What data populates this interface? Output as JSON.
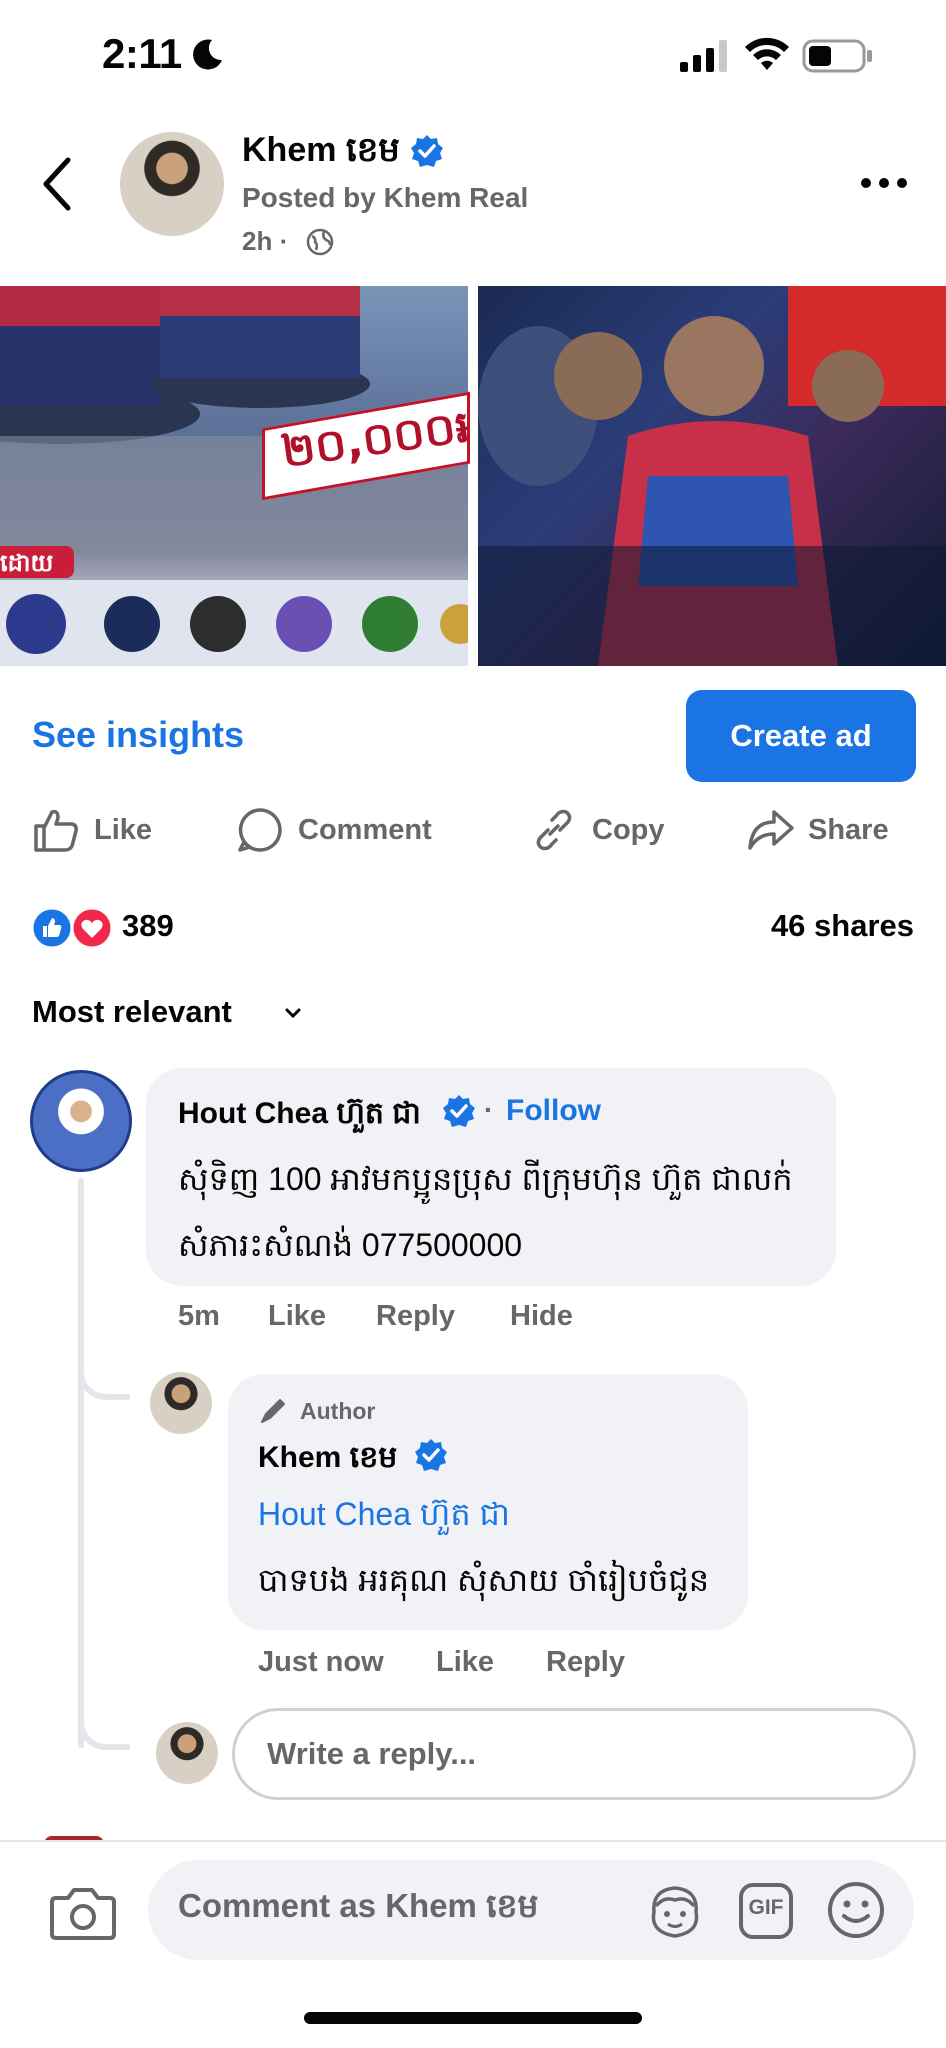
{
  "status_bar": {
    "time": "2:11"
  },
  "post": {
    "author_name": "Khem ខេម",
    "posted_by": "Posted by Khem Real",
    "time": "2h ·",
    "image_price_text": "២០,០០០៛",
    "image_banner_text": "ដោយ"
  },
  "insights": {
    "see_insights": "See insights",
    "create_ad": "Create ad"
  },
  "actions": {
    "like": "Like",
    "comment": "Comment",
    "copy": "Copy",
    "share": "Share"
  },
  "stats": {
    "reactions_count": "389",
    "shares": "46 shares"
  },
  "sort": {
    "label": "Most relevant"
  },
  "comment1": {
    "name": "Hout Chea ហ៊ួត ជា",
    "dot": "·",
    "follow": "Follow",
    "text": "សុំទិញ 100 អាវមកប្អូនប្រុស ពីក្រុមហ៊ុន ហ៊ួត ជាលក់ សំភារះសំណង់ 077500000",
    "time": "5m",
    "like": "Like",
    "reply": "Reply",
    "hide": "Hide"
  },
  "reply1": {
    "badge": "Author",
    "name": "Khem ខេម",
    "mention": "Hout Chea ហ៊ួត ជា",
    "text": "បាទបង អរគុណ សុំសាយ ចាំរៀបចំជូន",
    "time": "Just now",
    "like": "Like",
    "reply": "Reply"
  },
  "write_reply": {
    "placeholder": "Write a reply..."
  },
  "bottom_bar": {
    "placeholder": "Comment as Khem ខេម",
    "gif": "GIF"
  },
  "colors": {
    "accent": "#1b74e4",
    "secondary_text": "#65676b",
    "bubble": "#f0f2f5"
  }
}
